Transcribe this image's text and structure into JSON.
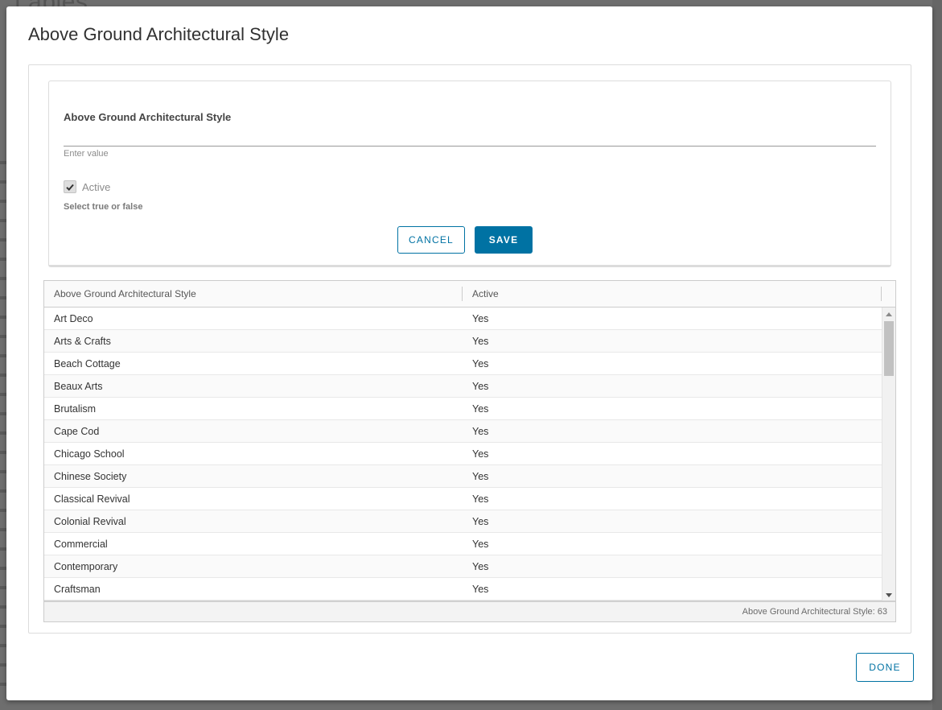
{
  "background": {
    "heading": "Lables"
  },
  "modal": {
    "title": "Above Ground Architectural Style"
  },
  "form": {
    "field_label": "Above Ground Architectural Style",
    "input_value": "",
    "input_helper": "Enter value",
    "active_checked": true,
    "active_label": "Active",
    "active_helper": "Select true or false",
    "cancel_label": "CANCEL",
    "save_label": "SAVE"
  },
  "grid": {
    "columns": [
      "Above Ground Architectural Style",
      "Active"
    ],
    "rows": [
      [
        "Art Deco",
        "Yes"
      ],
      [
        "Arts & Crafts",
        "Yes"
      ],
      [
        "Beach Cottage",
        "Yes"
      ],
      [
        "Beaux Arts",
        "Yes"
      ],
      [
        "Brutalism",
        "Yes"
      ],
      [
        "Cape Cod",
        "Yes"
      ],
      [
        "Chicago School",
        "Yes"
      ],
      [
        "Chinese Society",
        "Yes"
      ],
      [
        "Classical Revival",
        "Yes"
      ],
      [
        "Colonial Revival",
        "Yes"
      ],
      [
        "Commercial",
        "Yes"
      ],
      [
        "Contemporary",
        "Yes"
      ],
      [
        "Craftsman",
        "Yes"
      ]
    ],
    "footer": "Above Ground Architectural Style: 63"
  },
  "footer": {
    "done_label": "DONE"
  },
  "icons": {
    "checkbox": "checkmark-icon",
    "scroll_up": "scroll-up-arrow-icon",
    "scroll_down": "scroll-down-arrow-icon"
  },
  "colors": {
    "accent": "#0072a3"
  }
}
